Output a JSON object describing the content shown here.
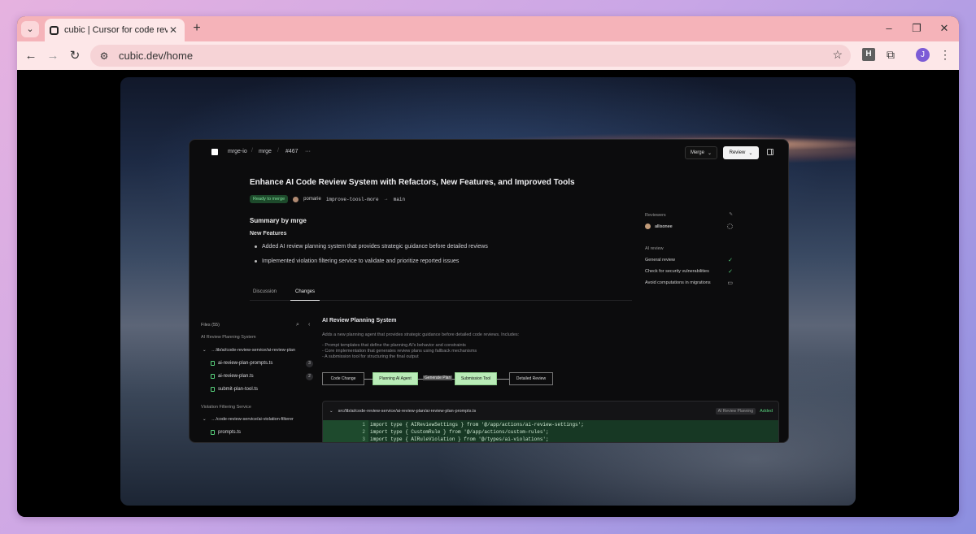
{
  "browser": {
    "tab_title": "cubic | Cursor for code review",
    "url": "cubic.dev/home",
    "avatar_initial": "J",
    "ext_h": "H"
  },
  "app": {
    "breadcrumb": [
      "mrge-io",
      "mrge",
      "#467",
      "···"
    ],
    "merge_label": "Merge",
    "review_label": "Review",
    "pr_title": "Enhance AI Code Review System with Refactors, New Features, and Improved Tools",
    "status_badge": "Ready to merge",
    "author": "pomarie",
    "source_branch": "improve-toosl-more",
    "target_branch": "main",
    "summary_title": "Summary by mrge",
    "new_features_title": "New Features",
    "features": [
      "Added AI review planning system that provides strategic guidance before detailed reviews",
      "Implemented violation filtering service to validate and prioritize reported issues"
    ],
    "tabs": [
      "Discussion",
      "Changes"
    ],
    "active_tab": "Changes",
    "sidebar": {
      "reviewers_label": "Reviewers",
      "reviewer": "allisonee",
      "ai_review_label": "AI review",
      "checks": [
        "General review",
        "Check for security vulnerabilities",
        "Avoid computations in migrations"
      ]
    },
    "files": {
      "header": "Files (55)",
      "section1": "AI Review Planning System",
      "dir1": "…lib/ai/code-review-service/ai-review-plan",
      "files1": [
        {
          "name": "ai-review-plan-prompts.ts",
          "count": "3"
        },
        {
          "name": "ai-review-plan.ts",
          "count": "2"
        },
        {
          "name": "submit-plan-tool.ts",
          "count": ""
        }
      ],
      "section2": "Violation Filtering Service",
      "dir2": "…/code-review-service/ai-violation-filterer",
      "files2": [
        {
          "name": "prompts.ts"
        }
      ]
    },
    "detail": {
      "title": "AI Review Planning System",
      "description": "Adds a new planning agent that provides strategic guidance before detailed code reviews. Includes:",
      "list": [
        "- Prompt templates that define the planning AI's behavior and constraints",
        "- Core implementation that generates review plans using fallback mechanisms",
        "- A submission tool for structuring the final output"
      ],
      "flow": [
        "Code Change",
        "Planning AI Agent",
        "Generate Plan",
        "Submission Tool",
        "Detailed Review"
      ]
    },
    "code": {
      "path": "src/lib/ai/code-review-service/ai-review-plan/ai-review-plan-prompts.ts",
      "tag": "AI Review Planning",
      "status": "Added",
      "lines": [
        {
          "n": "1",
          "t": "import type { AIReviewSettings } from '@/app/actions/ai-review-settings';"
        },
        {
          "n": "2",
          "t": "import type { CustomRule } from '@/app/actions/custom-rules';"
        },
        {
          "n": "3",
          "t": "import type { AIRuleViolation } from '@/types/ai-violations';"
        }
      ]
    }
  }
}
